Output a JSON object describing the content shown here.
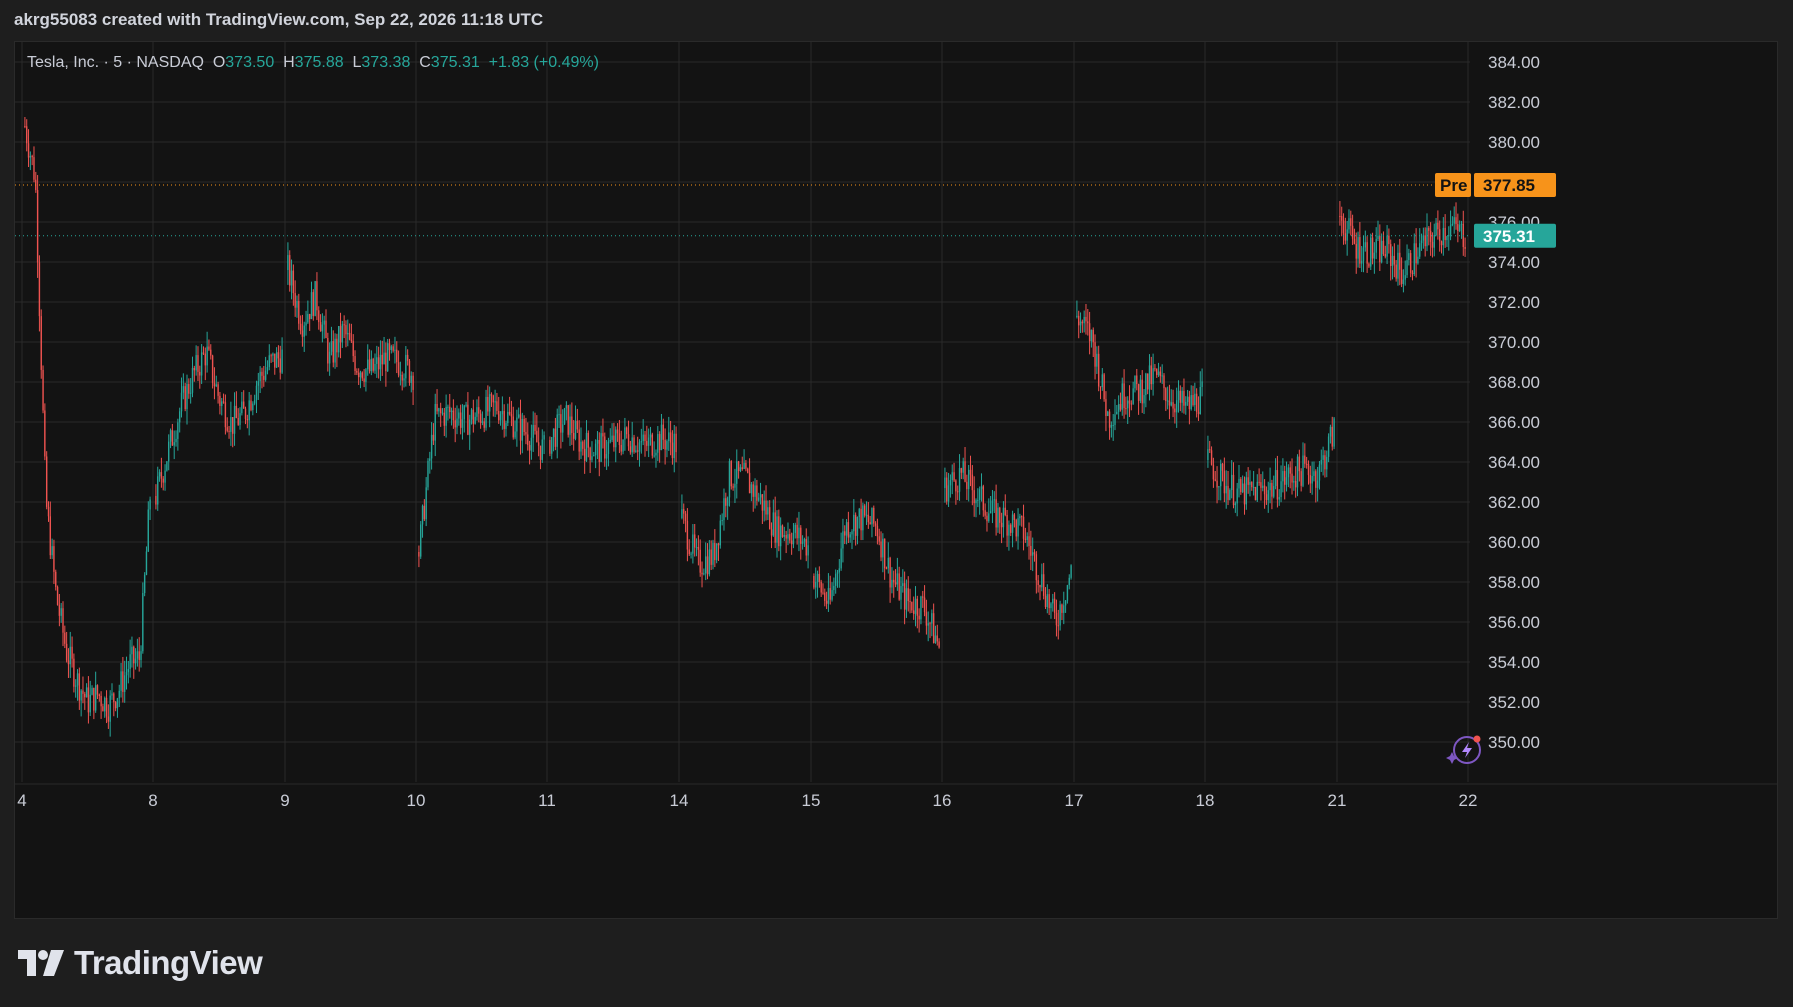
{
  "header": {
    "credit": "akrg55083 created with TradingView.com, Sep 22, 2026 11:18 UTC"
  },
  "legend": {
    "symbol": "Tesla, Inc. · 5 · NASDAQ",
    "open_label": "O",
    "open": "373.50",
    "high_label": "H",
    "high": "375.88",
    "low_label": "L",
    "low": "373.38",
    "close_label": "C",
    "close": "375.31",
    "change": "+1.83 (+0.49%)"
  },
  "price_tags": {
    "pre_label": "Pre",
    "pre_value": "377.85",
    "last_value": "375.31"
  },
  "footer": {
    "brand": "TradingView",
    "logo_icon": "tradingview-logo-icon"
  },
  "colors": {
    "up": "#26a69a",
    "down": "#ef5350",
    "pre": "#f7931a",
    "grid": "#2a2a2a",
    "text": "#c9ccd6",
    "background": "#131313"
  },
  "chart_data": {
    "type": "candlestick",
    "symbol": "TSLA",
    "interval": "5",
    "ylim": [
      348,
      385
    ],
    "yticks": [
      350,
      352,
      354,
      356,
      358,
      360,
      362,
      364,
      366,
      368,
      370,
      372,
      374,
      376,
      378,
      380,
      382,
      384
    ],
    "x_days": [
      "4",
      "8",
      "9",
      "10",
      "11",
      "14",
      "15",
      "16",
      "17",
      "18",
      "21",
      "22"
    ],
    "pre_market_price": 377.85,
    "last_price": 375.31,
    "grid": true,
    "session_closes": [
      {
        "day": "4",
        "closes": [
          380.8,
          378.2,
          362.1,
          357.3,
          354.5,
          353.1,
          352.0,
          352.4,
          351.8,
          352.6,
          353.9,
          354.2,
          362.3
        ]
      },
      {
        "day": "8",
        "closes": [
          362.3,
          364.6,
          366.8,
          368.4,
          369.5,
          367.2,
          365.9,
          366.4,
          368.0,
          368.9,
          369.3
        ]
      },
      {
        "day": "9",
        "closes": [
          373.6,
          371.0,
          372.3,
          369.1,
          370.6,
          368.8,
          368.5,
          369.2,
          369.0,
          368.4
        ]
      },
      {
        "day": "10",
        "closes": [
          359.5,
          366.2,
          366.5,
          366.1,
          366.4,
          366.8,
          366.0,
          365.4,
          364.6
        ]
      },
      {
        "day": "11",
        "closes": [
          365.1,
          366.2,
          364.9,
          364.6,
          364.9,
          365.3,
          364.8,
          365.2,
          364.9
        ]
      },
      {
        "day": "14",
        "closes": [
          361.2,
          358.9,
          359.3,
          363.3,
          363.2,
          362.1,
          360.6,
          360.5,
          359.8
        ]
      },
      {
        "day": "15",
        "closes": [
          358.3,
          356.8,
          360.8,
          361.2,
          360.8,
          358.1,
          357.0,
          356.8,
          354.8
        ]
      },
      {
        "day": "16",
        "closes": [
          362.7,
          363.4,
          362.4,
          361.4,
          361.1,
          360.5,
          358.4,
          356.0,
          358.5
        ]
      },
      {
        "day": "17",
        "closes": [
          371.3,
          370.1,
          366.2,
          367.4,
          367.6,
          368.3,
          367.2,
          366.7,
          367.3
        ]
      },
      {
        "day": "18",
        "closes": [
          364.1,
          363.0,
          362.4,
          362.6,
          362.7,
          363.2,
          363.6,
          363.4,
          365.6
        ]
      },
      {
        "day": "21",
        "closes": [
          376.3,
          374.8,
          374.5,
          374.6,
          373.4,
          374.6,
          375.3,
          375.8,
          375.31
        ]
      }
    ]
  }
}
